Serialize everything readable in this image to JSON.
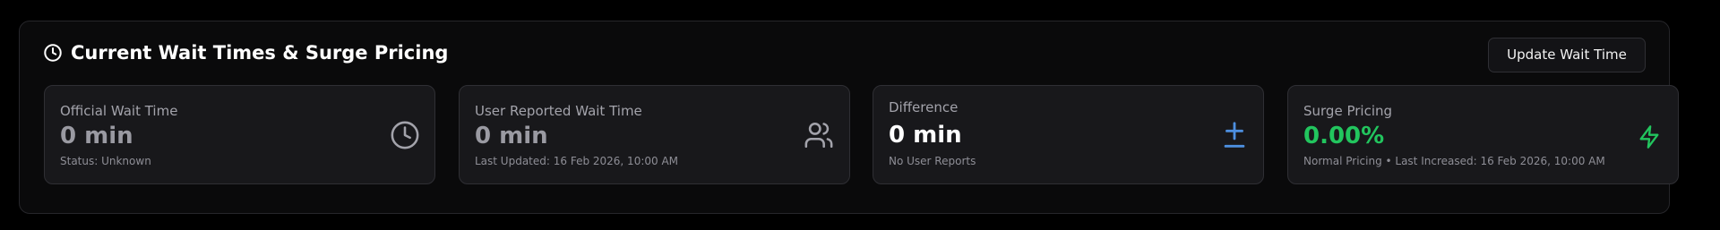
{
  "panel": {
    "title": "Current Wait Times & Surge Pricing",
    "update_button_label": "Update Wait Time"
  },
  "cards": [
    {
      "label": "Official Wait Time",
      "value": "0 min",
      "sub": "Status: Unknown",
      "icon": "clock-icon",
      "value_color": "#9a9aa2"
    },
    {
      "label": "User Reported Wait Time",
      "value": "0 min",
      "sub": "Last Updated: 16 Feb 2026, 10:00 AM",
      "icon": "users-icon",
      "value_color": "#9a9aa2"
    },
    {
      "label": "Difference",
      "value": "0 min",
      "sub": "No User Reports",
      "icon": "plus-minus-icon",
      "value_color": "#ffffff",
      "icon_color": "#4d8fe0"
    },
    {
      "label": "Surge Pricing",
      "value": "0.00%",
      "sub": "Normal Pricing • Last Increased: 16 Feb 2026, 10:00 AM",
      "icon": "lightning-icon",
      "value_color": "#22c55e",
      "icon_color": "#22c55e"
    }
  ]
}
